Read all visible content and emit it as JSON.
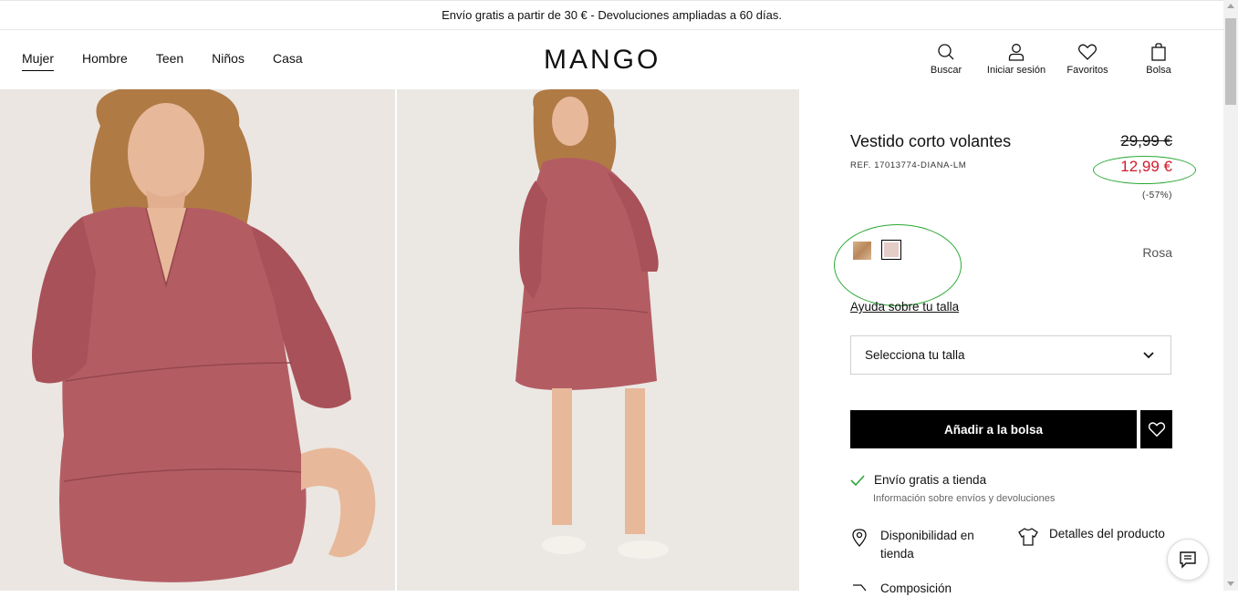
{
  "promo_bar": {
    "text": "Envío gratis a partir de 30 € - Devoluciones ampliadas a 60 días."
  },
  "header": {
    "logo": "MANGO",
    "nav": [
      {
        "label": "Mujer",
        "active": true
      },
      {
        "label": "Hombre"
      },
      {
        "label": "Teen"
      },
      {
        "label": "Niños"
      },
      {
        "label": "Casa"
      }
    ],
    "tools": {
      "search": {
        "label": "Buscar",
        "icon": "search-icon"
      },
      "login": {
        "label": "Iniciar sesión",
        "icon": "user-icon"
      },
      "favorites": {
        "label": "Favoritos",
        "icon": "heart-icon"
      },
      "bag": {
        "label": "Bolsa",
        "icon": "bag-icon"
      }
    }
  },
  "gallery": {
    "images": [
      {
        "alt": "Vestido corto volantes - close-up",
        "color": "#b35d63"
      },
      {
        "alt": "Vestido corto volantes - full body",
        "color": "#b35d63"
      }
    ]
  },
  "product": {
    "title": "Vestido corto volantes",
    "reference": "REF. 17013774-DIANA-LM",
    "old_price": "29,99 €",
    "new_price": "12,99 €",
    "discount": "(-57%)",
    "colors": {
      "selected_name": "Rosa",
      "swatches": [
        {
          "name": "swatch-camel",
          "color": "#c9a27a"
        },
        {
          "name": "swatch-rosa",
          "color": "#e4ccc7",
          "selected": true
        }
      ]
    },
    "size_help": "Ayuda sobre tu talla",
    "size_select": {
      "label": "Selecciona tu talla"
    },
    "add_to_bag": "Añadir a la bolsa",
    "shipping": {
      "title": "Envío gratis a tienda",
      "info_link": "Información sobre envíos y devoluciones"
    },
    "availability": "Disponibilidad en tienda",
    "details": "Detalles del producto",
    "more": "Composición"
  },
  "accent_colors": {
    "sale_red": "#d01b2a",
    "annotation_green": "#2aa834",
    "dress": "#b35d63"
  }
}
